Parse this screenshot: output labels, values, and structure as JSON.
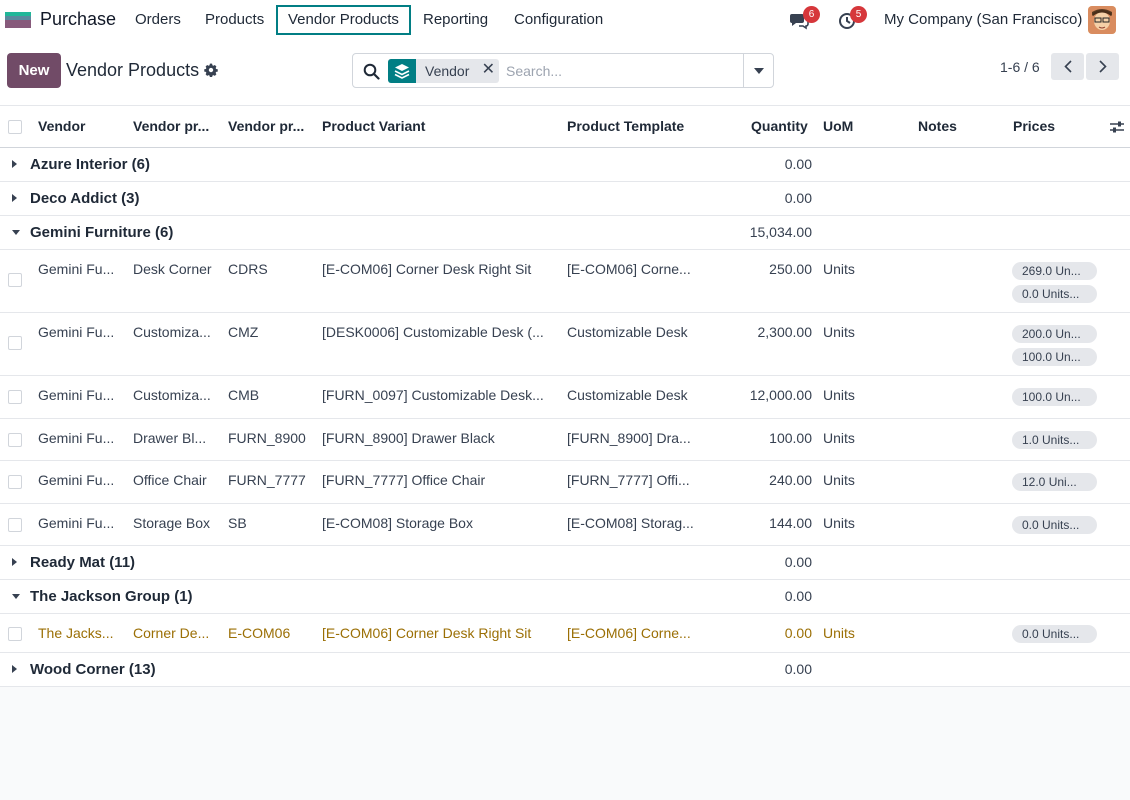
{
  "navbar": {
    "app_name": "Purchase",
    "menu": [
      "Orders",
      "Products",
      "Vendor Products",
      "Reporting",
      "Configuration"
    ],
    "messages_count": "6",
    "activities_count": "5",
    "company": "My Company (San Francisco)"
  },
  "control": {
    "new_label": "New",
    "title": "Vendor Products",
    "facet_label": "Vendor",
    "search_placeholder": "Search...",
    "pager": "1-6 / 6"
  },
  "columns": [
    "Vendor",
    "Vendor pr...",
    "Vendor pr...",
    "Product Variant",
    "Product Template",
    "Quantity",
    "UoM",
    "Notes",
    "Prices"
  ],
  "groups": [
    {
      "name": "Azure Interior (6)",
      "qty": "0.00",
      "open": false
    },
    {
      "name": "Deco Addict (3)",
      "qty": "0.00",
      "open": false
    },
    {
      "name": "Gemini Furniture (6)",
      "qty": "15,034.00",
      "open": true
    },
    {
      "name": "Ready Mat (11)",
      "qty": "0.00",
      "open": false
    },
    {
      "name": "The Jackson Group (1)",
      "qty": "0.00",
      "open": true
    },
    {
      "name": "Wood Corner (13)",
      "qty": "0.00",
      "open": false
    }
  ],
  "gemini_rows": [
    {
      "vendor": "Gemini Fu...",
      "vname": "Desk Corner",
      "vcode": "CDRS",
      "variant": "[E-COM06] Corner Desk Right Sit",
      "template": "[E-COM06] Corne...",
      "qty": "250.00",
      "uom": "Units",
      "prices": [
        "269.0 Un...",
        "0.0 Units..."
      ]
    },
    {
      "vendor": "Gemini Fu...",
      "vname": "Customiza...",
      "vcode": "CMZ",
      "variant": "[DESK0006] Customizable Desk (...",
      "template": "Customizable Desk",
      "qty": "2,300.00",
      "uom": "Units",
      "prices": [
        "200.0 Un...",
        "100.0 Un..."
      ]
    },
    {
      "vendor": "Gemini Fu...",
      "vname": "Customiza...",
      "vcode": "CMB",
      "variant": "[FURN_0097] Customizable Desk...",
      "template": "Customizable Desk",
      "qty": "12,000.00",
      "uom": "Units",
      "prices": [
        "100.0 Un..."
      ]
    },
    {
      "vendor": "Gemini Fu...",
      "vname": "Drawer Bl...",
      "vcode": "FURN_8900",
      "variant": "[FURN_8900] Drawer Black",
      "template": "[FURN_8900] Dra...",
      "qty": "100.00",
      "uom": "Units",
      "prices": [
        "1.0 Units..."
      ]
    },
    {
      "vendor": "Gemini Fu...",
      "vname": "Office Chair",
      "vcode": "FURN_7777",
      "variant": "[FURN_7777] Office Chair",
      "template": "[FURN_7777] Offi...",
      "qty": "240.00",
      "uom": "Units",
      "prices": [
        "12.0 Uni..."
      ]
    },
    {
      "vendor": "Gemini Fu...",
      "vname": "Storage Box",
      "vcode": "SB",
      "variant": "[E-COM08] Storage Box",
      "template": "[E-COM08] Storag...",
      "qty": "144.00",
      "uom": "Units",
      "prices": [
        "0.0 Units..."
      ]
    }
  ],
  "jackson_rows": [
    {
      "vendor": "The Jacks...",
      "vname": "Corner De...",
      "vcode": "E-COM06",
      "variant": "[E-COM06] Corner Desk Right Sit",
      "template": "[E-COM06] Corne...",
      "qty": "0.00",
      "uom": "Units",
      "prices": [
        "0.0 Units..."
      ]
    }
  ],
  "colors": {
    "brand": "#714b67",
    "accent": "#017e84",
    "badge": "#d6373b",
    "highlight_text": "#9b6f05"
  }
}
